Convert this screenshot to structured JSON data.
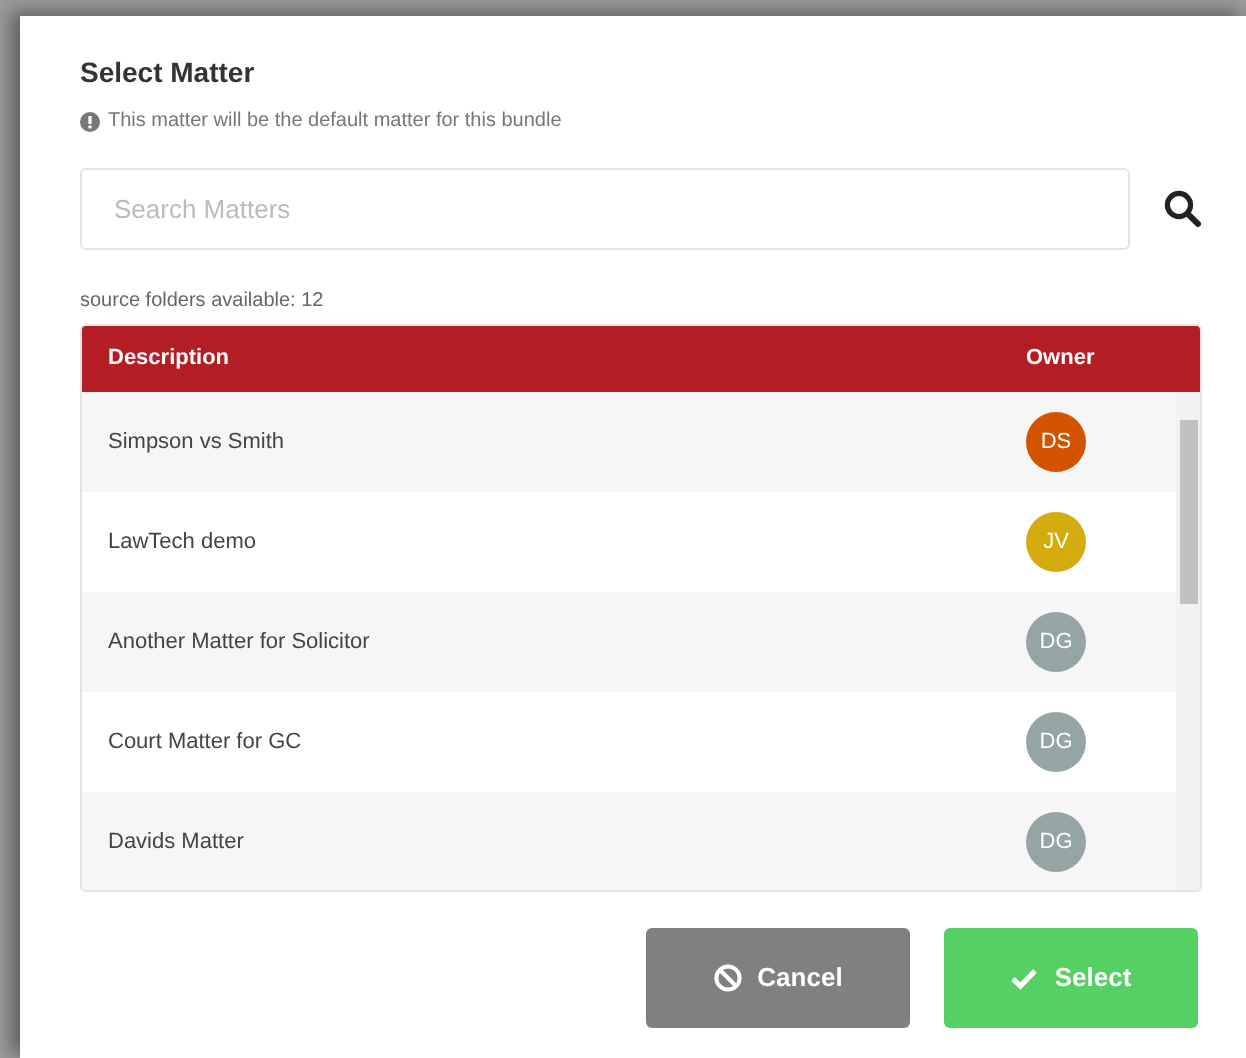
{
  "dialog": {
    "title": "Select Matter",
    "info": "This matter will be the default matter for this bundle"
  },
  "search": {
    "placeholder": "Search Matters"
  },
  "count_label": "source folders available: 12",
  "table": {
    "columns": [
      "Description",
      "Owner"
    ],
    "rows": [
      {
        "description": "Simpson vs Smith",
        "owner": "DS",
        "color": "#d35400"
      },
      {
        "description": "LawTech demo",
        "owner": "JV",
        "color": "#d4ac0d"
      },
      {
        "description": "Another Matter for Solicitor",
        "owner": "DG",
        "color": "#95a5a6"
      },
      {
        "description": "Court Matter for GC",
        "owner": "DG",
        "color": "#95a5a6"
      },
      {
        "description": "Davids Matter",
        "owner": "DG",
        "color": "#95a5a6"
      }
    ]
  },
  "buttons": [
    {
      "label": "Cancel",
      "kind": "cancel"
    },
    {
      "label": "Select",
      "kind": "confirm"
    }
  ]
}
